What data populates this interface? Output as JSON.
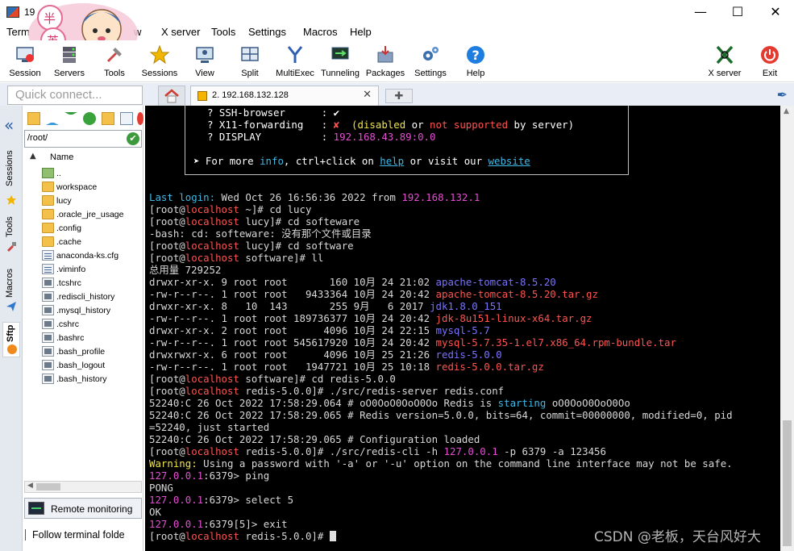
{
  "window": {
    "title": "19",
    "min_glyph": "—",
    "max_glyph": "☐",
    "close_glyph": "✕"
  },
  "menu": [
    "Term",
    "w",
    "X server",
    "Tools",
    "Settings",
    "Macros",
    "Help"
  ],
  "toolbar": {
    "items": [
      "Session",
      "Servers",
      "Tools",
      "Sessions",
      "View",
      "Split",
      "MultiExec",
      "Tunneling",
      "Packages",
      "Settings",
      "Help"
    ],
    "xserver": "X server",
    "exit": "Exit"
  },
  "quick_connect": {
    "placeholder": "Quick connect..."
  },
  "tab": {
    "title": "2. 192.168.132.128",
    "close": "✕",
    "new": "✚"
  },
  "sidebar": {
    "tabs": [
      "Sessions",
      "Tools",
      "Macros",
      "Sftp"
    ],
    "collapse": "«"
  },
  "sftp": {
    "path": "/root/",
    "column": "Name",
    "files": [
      "..",
      "workspace",
      "lucy",
      ".oracle_jre_usage",
      ".config",
      ".cache",
      "anaconda-ks.cfg",
      ".viminfo",
      ".tcshrc",
      ".rediscli_history",
      ".mysql_history",
      ".cshrc",
      ".bashrc",
      ".bash_profile",
      ".bash_logout",
      ".bash_history"
    ],
    "remote_monitoring": "Remote monitoring",
    "follow": "Follow terminal folde"
  },
  "terminal": {
    "box": {
      "ssh": "? SSH-browser      : ✔",
      "x11_a": "? X11-forwarding   : ",
      "x11_mark": "✘",
      "x11_b": "  (disabled ",
      "x11_or": "or ",
      "x11_not": "not supported",
      "x11_c": " by server)",
      "display_a": "? DISPLAY          : ",
      "display_b": "192.168.43.89:0.0",
      "more_a": "➤ For more ",
      "more_info": "info",
      "more_b": ", ctrl+click on ",
      "more_help": "help",
      "more_c": " or visit our ",
      "more_site": "website"
    },
    "last_login_a": "Last login:",
    "last_login_b": " Wed Oct 26 16:56:36 2022 from ",
    "last_login_ip": "192.168.132.1",
    "p_open": "[root@",
    "p_host": "localhost",
    "cmd1": " ~]# cd lucy",
    "cmd2": " lucy]# cd softeware",
    "err": "-bash: cd: softeware: 没有那个文件或目录",
    "cmd3": " lucy]# cd software",
    "cmd4": " software]# ll",
    "total": "总用量 729252",
    "ls": [
      {
        "meta": "drwxr-xr-x. 9 root root       160 10月 24 21:02 ",
        "name": "apache-tomcat-8.5.20",
        "kind": "blue"
      },
      {
        "meta": "-rw-r--r--. 1 root root   9433364 10月 24 20:42 ",
        "name": "apache-tomcat-8.5.20.tar.gz",
        "kind": "red"
      },
      {
        "meta": "drwxr-xr-x. 8   10  143       255 9月   6 2017 ",
        "name": "jdk1.8.0_151",
        "kind": "blue"
      },
      {
        "meta": "-rw-r--r--. 1 root root 189736377 10月 24 20:42 ",
        "name": "jdk-8u151-linux-x64.tar.gz",
        "kind": "red"
      },
      {
        "meta": "drwxr-xr-x. 2 root root      4096 10月 24 22:15 ",
        "name": "mysql-5.7",
        "kind": "blue"
      },
      {
        "meta": "-rw-r--r--. 1 root root 545617920 10月 24 20:42 ",
        "name": "mysql-5.7.35-1.el7.x86_64.rpm-bundle.tar",
        "kind": "red"
      },
      {
        "meta": "drwxrwxr-x. 6 root root      4096 10月 25 21:26 ",
        "name": "redis-5.0.0",
        "kind": "blue"
      },
      {
        "meta": "-rw-r--r--. 1 root root   1947721 10月 25 10:18 ",
        "name": "redis-5.0.0.tar.gz",
        "kind": "red"
      }
    ],
    "cmd5": " software]# cd redis-5.0.0",
    "cmd6": " redis-5.0.0]# ./src/redis-server redis.conf",
    "log1_a": "52240:C 26 Oct 2022 17:58:29.064 # oO0OoO0OoO0Oo Redis is ",
    "log1_b": "starting",
    "log1_c": " oO0OoO0OoO0Oo",
    "log2": "52240:C 26 Oct 2022 17:58:29.065 # Redis version=5.0.0, bits=64, commit=00000000, modified=0, pid",
    "log3": "=52240, just started",
    "log4": "52240:C 26 Oct 2022 17:58:29.065 # Configuration loaded",
    "cmd7_a": " redis-5.0.0]# ./src/redis-cli -h ",
    "cmd7_ip": "127.0.0.1",
    "cmd7_b": " -p 6379 -a 123456",
    "warn_a": "Warning:",
    "warn_b": " Using a password with '-a' or '-u' option on the command line interface may not be safe.",
    "cli_ip": "127.0.0.1",
    "cli1": ":6379> ping",
    "pong": "PONG",
    "cli2": ":6379> select 5",
    "ok": "OK",
    "cli3": ":6379[5]> exit",
    "cmd8": " redis-5.0.0]# "
  },
  "watermark": "CSDN @老板，天台风好大",
  "colors": {
    "cyan": "#3fb9e6",
    "magenta": "#e24fd0",
    "red": "#ff5450",
    "blue": "#7a73ff",
    "yellow": "#f0e44a"
  }
}
